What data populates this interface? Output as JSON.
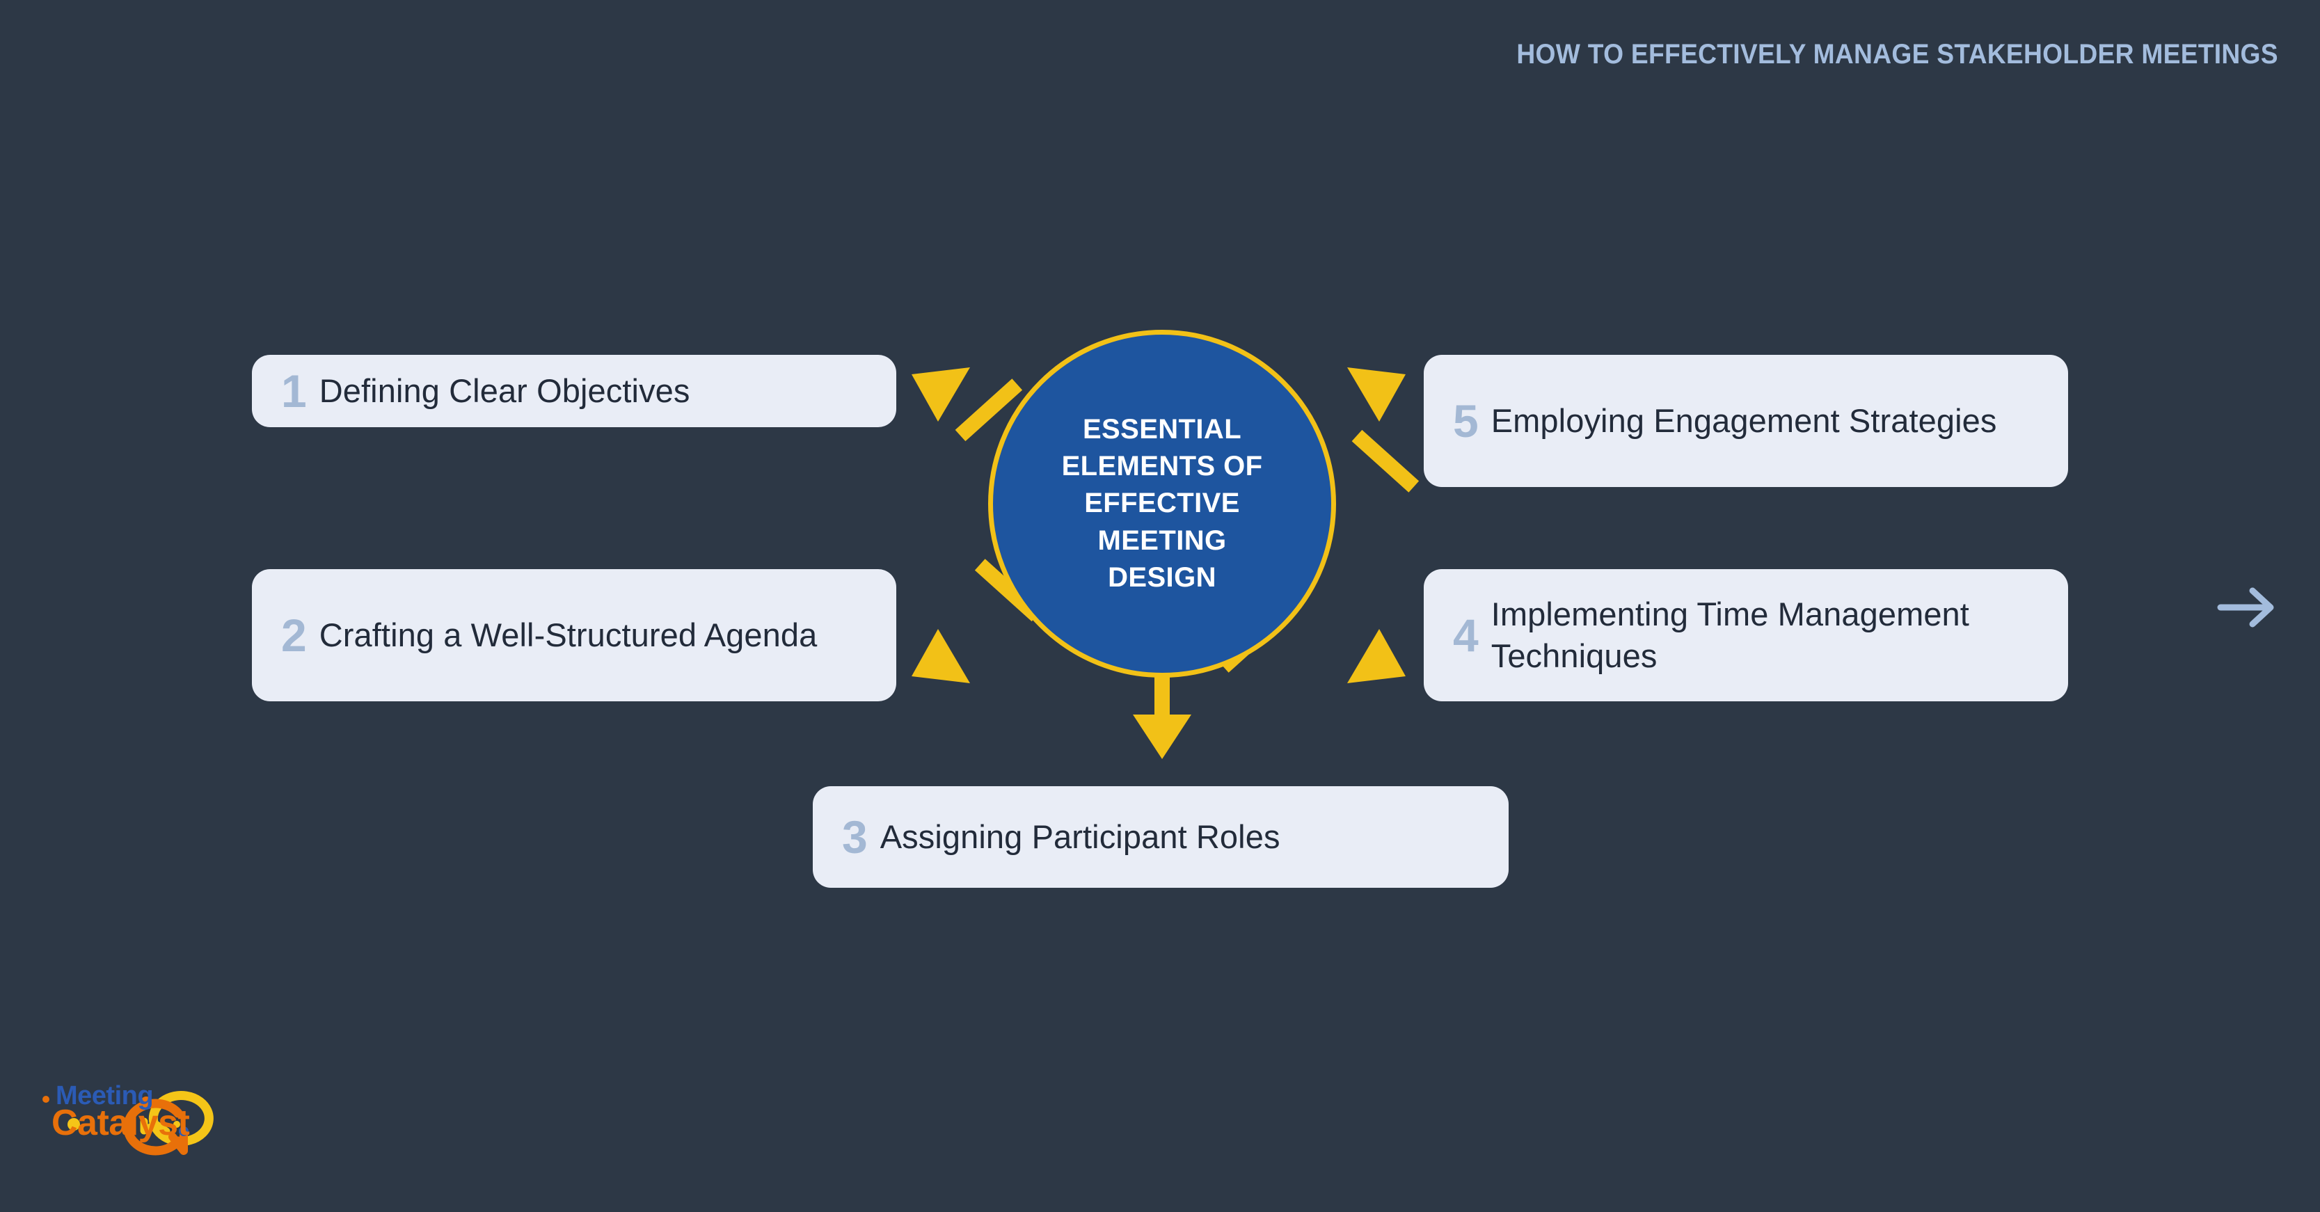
{
  "header": {
    "title": "HOW TO EFFECTIVELY MANAGE STAKEHOLDER MEETINGS"
  },
  "center": {
    "label": "ESSENTIAL ELEMENTS OF EFFECTIVE MEETING DESIGN"
  },
  "cards": [
    {
      "number": "1",
      "text": "Defining Clear Objectives"
    },
    {
      "number": "2",
      "text": "Crafting a Well-Structured Agenda"
    },
    {
      "number": "3",
      "text": "Assigning Participant Roles"
    },
    {
      "number": "4",
      "text": "Implementing Time Management Techniques"
    },
    {
      "number": "5",
      "text": "Employing Engagement Strategies"
    }
  ],
  "navigation": {
    "next_label": "→"
  },
  "logo": {
    "line1": "Meeting",
    "line2": "Catalyst"
  },
  "colors": {
    "background": "#2d3846",
    "card_background": "#e9edf6",
    "card_text": "#222b3a",
    "card_number": "#a3b8d4",
    "circle_fill": "#1e559f",
    "accent_yellow": "#f2c117",
    "header_text": "#a3bcdd",
    "logo_blue": "#2b5bb5",
    "logo_orange": "#e8700a"
  }
}
